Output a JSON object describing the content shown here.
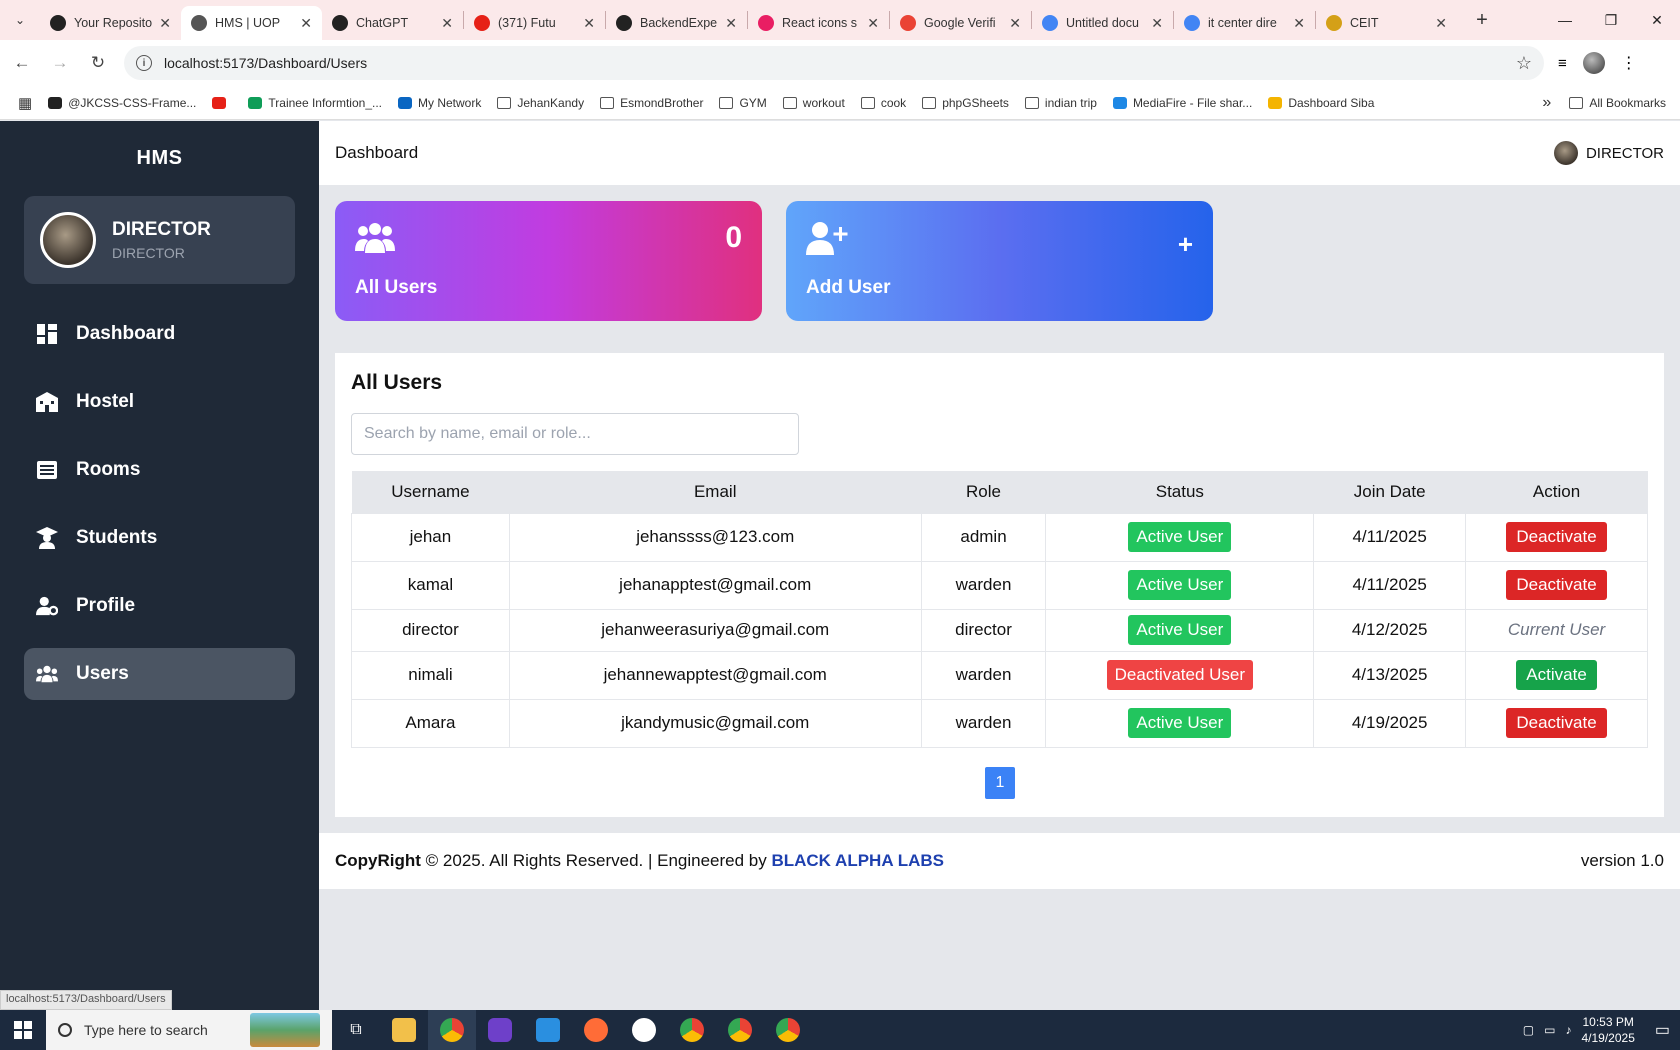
{
  "browser": {
    "tabs": [
      {
        "title": "Your Reposito",
        "color": "#222"
      },
      {
        "title": "HMS | UOP",
        "color": "#555",
        "active": true
      },
      {
        "title": "ChatGPT",
        "color": "#222"
      },
      {
        "title": "(371) Futu",
        "color": "#e62117"
      },
      {
        "title": "BackendExpe",
        "color": "#222"
      },
      {
        "title": "React icons s",
        "color": "#e91e63"
      },
      {
        "title": "Google Verifi",
        "color": "#ea4335"
      },
      {
        "title": "Untitled docu",
        "color": "#4285f4"
      },
      {
        "title": "it center dire",
        "color": "#4285f4"
      },
      {
        "title": "CEIT",
        "color": "#d4a017"
      }
    ],
    "url": "localhost:5173/Dashboard/Users",
    "bookmarks": [
      {
        "label": "@JKCSS-CSS-Frame...",
        "icon": "github-icon"
      },
      {
        "label": "",
        "icon": "youtube-icon"
      },
      {
        "label": "Trainee Informtion_...",
        "icon": "sheets-icon"
      },
      {
        "label": "My Network",
        "icon": "linkedin-icon"
      },
      {
        "label": "JehanKandy",
        "icon": "folder-icon"
      },
      {
        "label": "EsmondBrother",
        "icon": "folder-icon"
      },
      {
        "label": "GYM",
        "icon": "folder-icon"
      },
      {
        "label": "workout",
        "icon": "folder-icon"
      },
      {
        "label": "cook",
        "icon": "folder-icon"
      },
      {
        "label": "phpGSheets",
        "icon": "folder-icon"
      },
      {
        "label": "indian trip",
        "icon": "folder-icon"
      },
      {
        "label": "MediaFire - File shar...",
        "icon": "mediafire-icon"
      },
      {
        "label": "Dashboard Siba",
        "icon": "sun-icon"
      }
    ],
    "all_bookmarks": "All Bookmarks",
    "status_url": "localhost:5173/Dashboard/Users"
  },
  "sidebar": {
    "brand": "HMS",
    "profile": {
      "name": "DIRECTOR",
      "role": "DIRECTOR"
    },
    "items": [
      {
        "label": "Dashboard",
        "icon": "dashboard-icon"
      },
      {
        "label": "Hostel",
        "icon": "hostel-icon"
      },
      {
        "label": "Rooms",
        "icon": "rooms-icon"
      },
      {
        "label": "Students",
        "icon": "students-icon"
      },
      {
        "label": "Profile",
        "icon": "profile-icon"
      },
      {
        "label": "Users",
        "icon": "users-icon",
        "active": true
      }
    ]
  },
  "header": {
    "title": "Dashboard",
    "user": "DIRECTOR"
  },
  "cards": {
    "all_users": {
      "label": "All Users",
      "count": "0"
    },
    "add_user": {
      "label": "Add User",
      "plus": "+"
    }
  },
  "users_panel": {
    "title": "All Users",
    "search_placeholder": "Search by name, email or role...",
    "columns": [
      "Username",
      "Email",
      "Role",
      "Status",
      "Join Date",
      "Action"
    ],
    "rows": [
      {
        "username": "jehan",
        "email": "jehanssss@123.com",
        "role": "admin",
        "status": "Active User",
        "join": "4/11/2025",
        "action": "Deactivate"
      },
      {
        "username": "kamal",
        "email": "jehanapptest@gmail.com",
        "role": "warden",
        "status": "Active User",
        "join": "4/11/2025",
        "action": "Deactivate"
      },
      {
        "username": "director",
        "email": "jehanweerasuriya@gmail.com",
        "role": "director",
        "status": "Active User",
        "join": "4/12/2025",
        "action": "Current User"
      },
      {
        "username": "nimali",
        "email": "jehannewapptest@gmail.com",
        "role": "warden",
        "status": "Deactivated User",
        "join": "4/13/2025",
        "action": "Activate"
      },
      {
        "username": "Amara",
        "email": "jkandymusic@gmail.com",
        "role": "warden",
        "status": "Active User",
        "join": "4/19/2025",
        "action": "Deactivate"
      }
    ],
    "page": "1"
  },
  "footer": {
    "copyright_bold": "CopyRight",
    "copyright_text": " © 2025. All Rights Reserved. | Engineered by ",
    "company": "BLACK ALPHA LABS",
    "version": "version 1.0"
  },
  "taskbar": {
    "search_placeholder": "Type here to search",
    "time": "10:53 PM",
    "date": "4/19/2025"
  }
}
